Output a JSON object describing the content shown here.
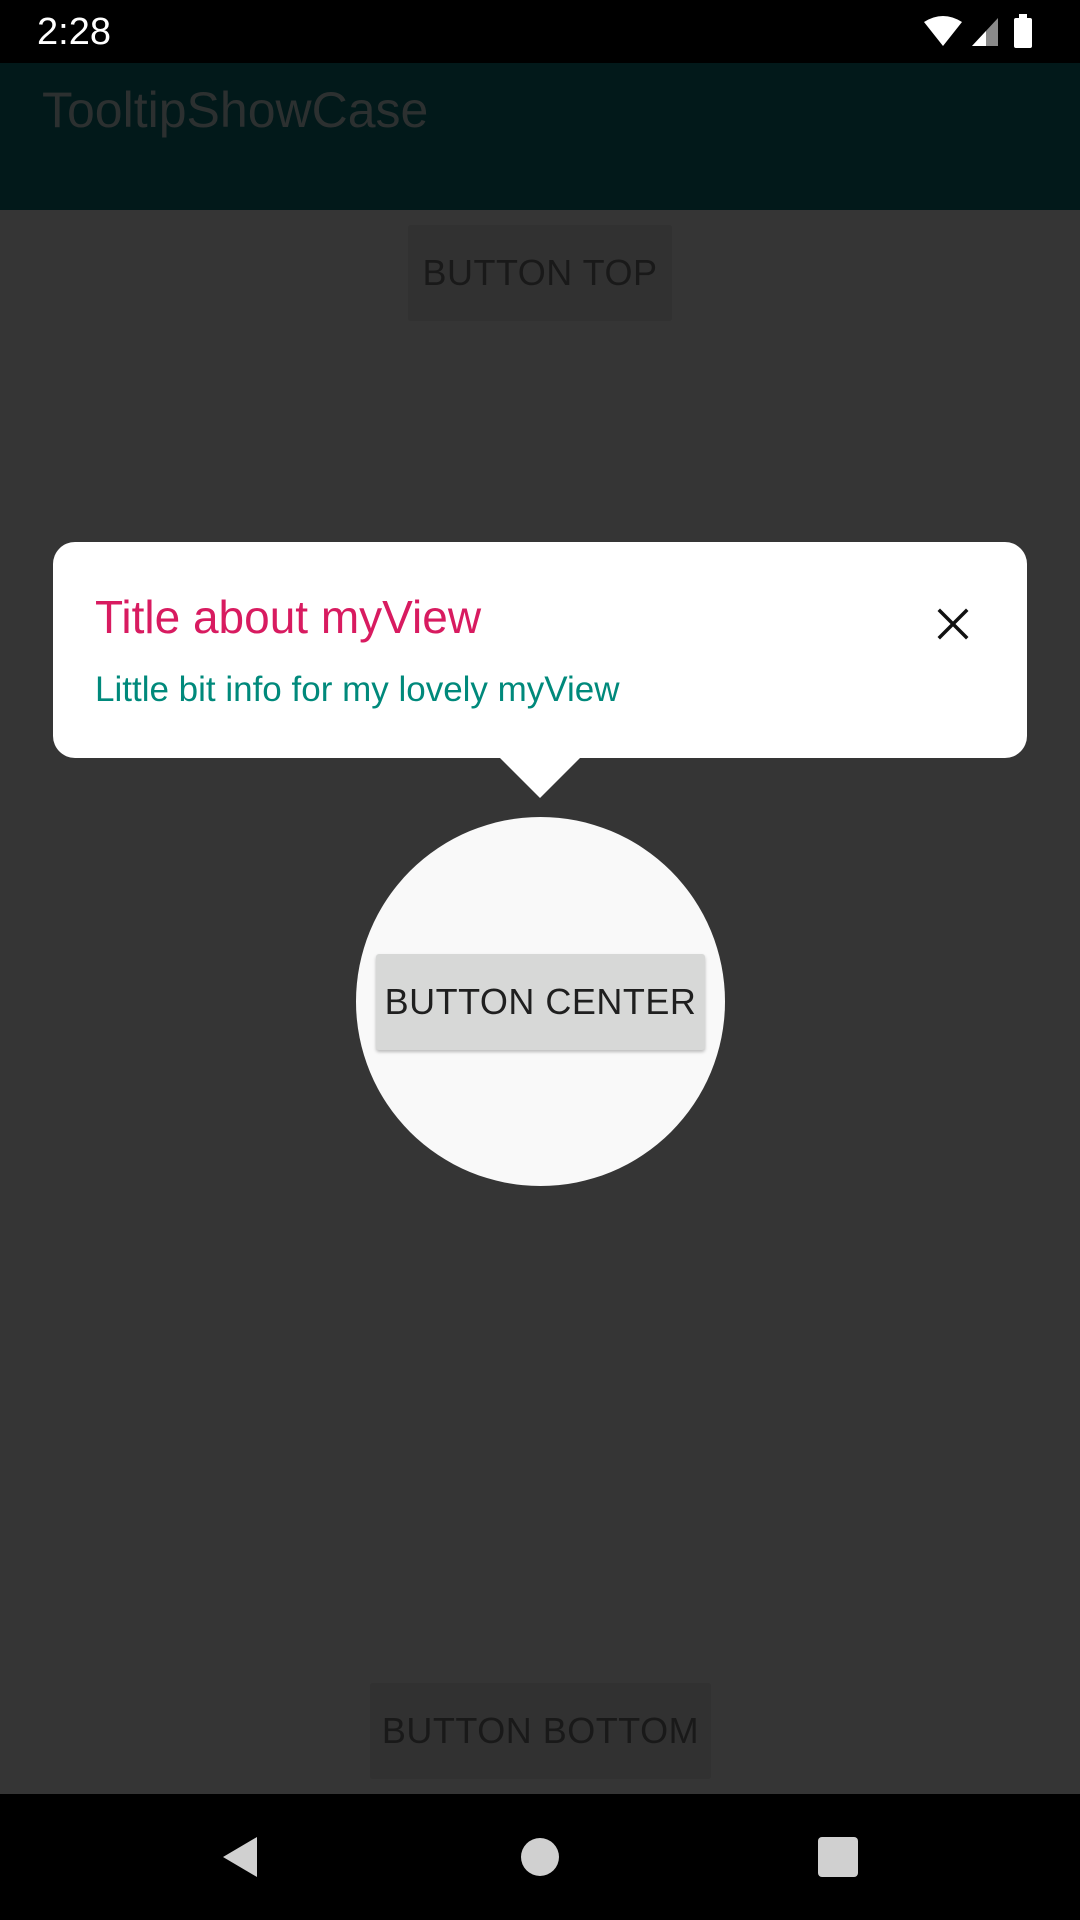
{
  "status_bar": {
    "time": "2:28",
    "icons": [
      "wifi-icon",
      "cell-signal-icon",
      "battery-icon"
    ]
  },
  "app_bar": {
    "title": "TooltipShowCase"
  },
  "buttons": {
    "top_label": "BUTTON TOP",
    "center_label": "BUTTON CENTER",
    "bottom_label": "BUTTON BOTTOM"
  },
  "tooltip": {
    "title": "Title about myView",
    "body": "Little bit info for my lovely myView",
    "close_icon": "close-icon",
    "title_color": "#d81b60",
    "body_color": "#00897b"
  },
  "nav_bar": {
    "icons": [
      "back-icon",
      "home-icon",
      "recents-icon"
    ]
  }
}
